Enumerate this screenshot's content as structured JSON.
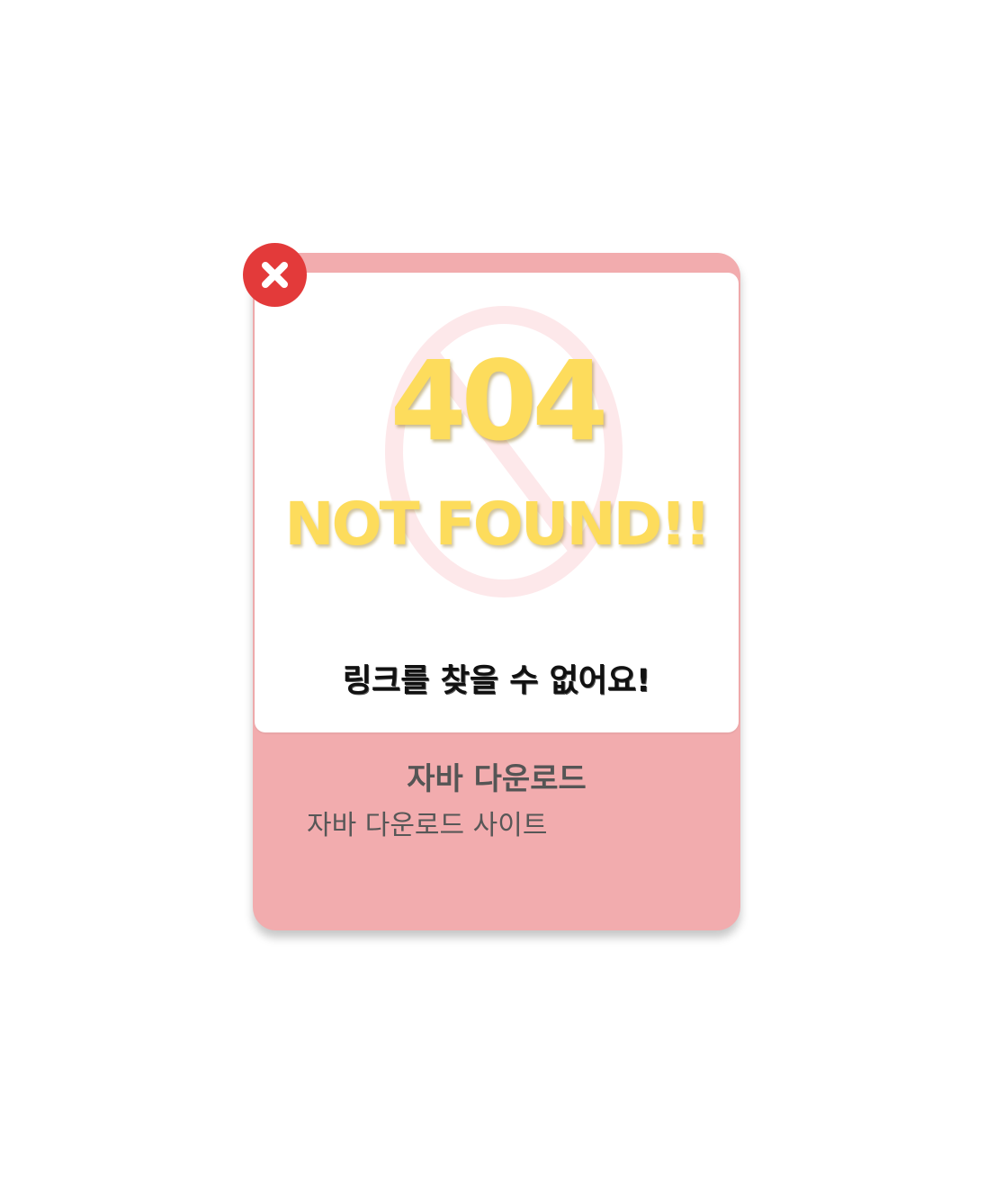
{
  "card": {
    "error_code": "404",
    "error_headline": "NOT FOUND!!",
    "error_message": "링크를 찾을 수 없어요!",
    "title": "자바 다운로드",
    "description": "자바 다운로드 사이트"
  },
  "icons": {
    "close": "close-icon",
    "background": "ban-icon"
  },
  "colors": {
    "card_background": "#f2acae",
    "close_button": "#e33a3a",
    "error_text": "#fddc5c",
    "ban_icon": "#fde8ea"
  }
}
